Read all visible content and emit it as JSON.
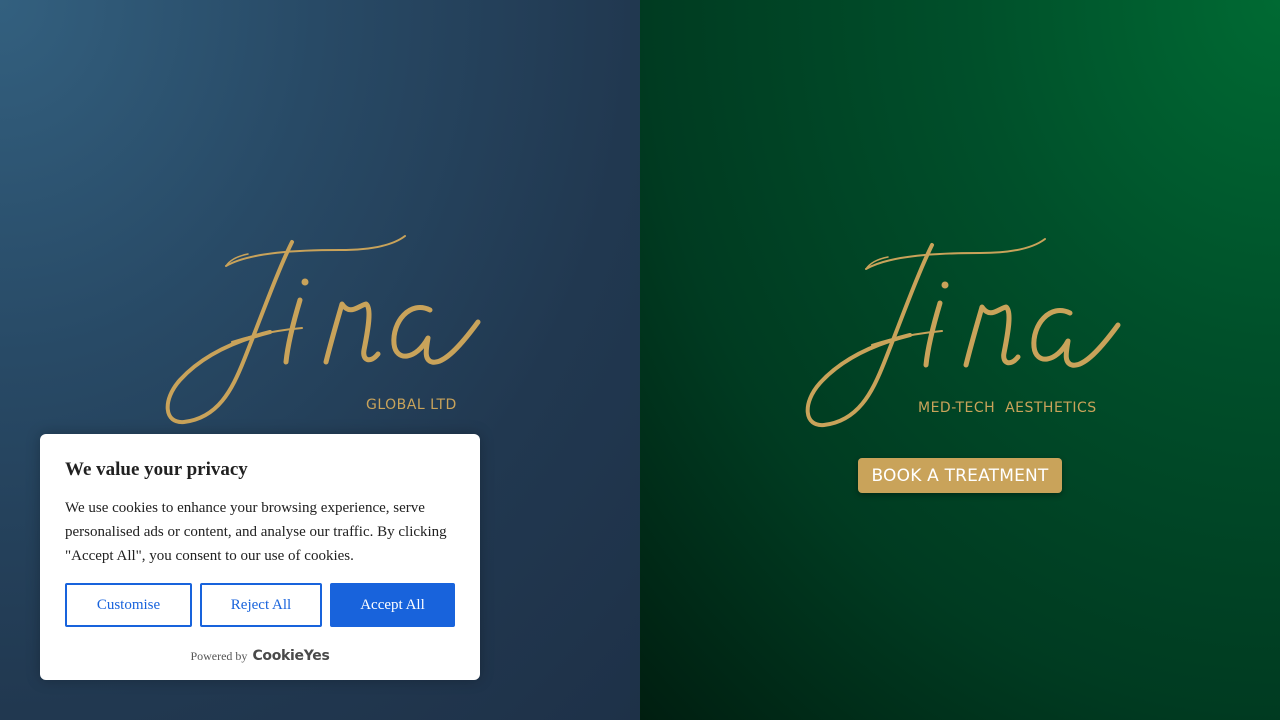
{
  "left_panel": {
    "brand_script": "Fina",
    "brand_subtitle": "GLOBAL LTD"
  },
  "right_panel": {
    "brand_script": "Fina",
    "brand_subtitle": "MED-TECH  AESTHETICS",
    "cta_label": "BOOK A TREATMENT"
  },
  "cookie_banner": {
    "title": "We value your privacy",
    "message": "We use cookies to enhance your browsing experience, serve personalised ads or content, and analyse our traffic. By clicking \"Accept All\", you consent to our use of cookies.",
    "customise_label": "Customise",
    "reject_label": "Reject All",
    "accept_label": "Accept All",
    "powered_by_label": "Powered by",
    "powered_by_brand": "CookieYes"
  },
  "colors": {
    "gold": "#c9a35a",
    "accent_blue": "#1863dc",
    "left_bg": "#284a66",
    "right_bg": "#004f2a"
  }
}
